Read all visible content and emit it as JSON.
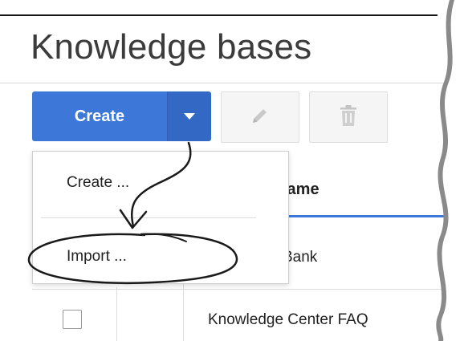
{
  "page": {
    "title": "Knowledge bases"
  },
  "toolbar": {
    "create_label": "Create",
    "caret_icon": "caret-down-icon",
    "edit_icon": "pencil-icon",
    "delete_icon": "trash-icon"
  },
  "menu": {
    "items": [
      {
        "label": "Create ..."
      },
      {
        "label": "Import ..."
      }
    ]
  },
  "table": {
    "column_header_visible": "lame",
    "rows": [
      {
        "name_visible": "Bank"
      },
      {
        "name": "Knowledge Center FAQ"
      }
    ]
  },
  "colors": {
    "accent": "#3d78d8",
    "accent_dark": "#3369c4"
  }
}
